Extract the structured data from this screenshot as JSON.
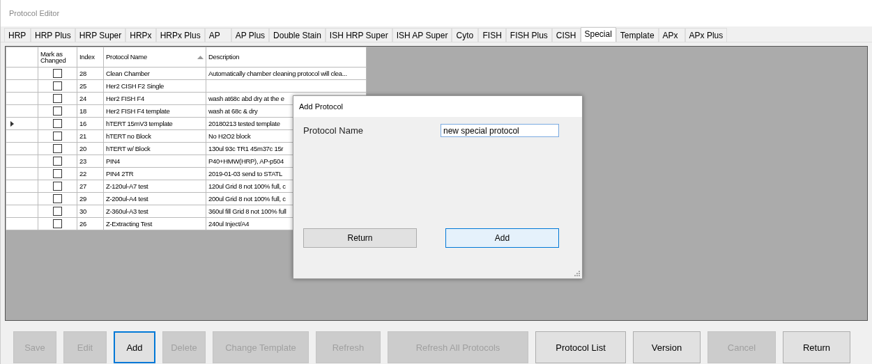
{
  "window": {
    "title": "Protocol Editor"
  },
  "tabs": [
    {
      "label": "HRP",
      "selected": false
    },
    {
      "label": "HRP Plus",
      "selected": false
    },
    {
      "label": "HRP Super",
      "selected": false
    },
    {
      "label": "HRPx",
      "selected": false
    },
    {
      "label": "HRPx Plus",
      "selected": false
    },
    {
      "label": "AP",
      "selected": false
    },
    {
      "label": "AP Plus",
      "selected": false
    },
    {
      "label": "Double Stain",
      "selected": false
    },
    {
      "label": "ISH HRP Super",
      "selected": false
    },
    {
      "label": "ISH AP Super",
      "selected": false
    },
    {
      "label": "Cyto",
      "selected": false
    },
    {
      "label": "FISH",
      "selected": false
    },
    {
      "label": "FISH Plus",
      "selected": false
    },
    {
      "label": "CISH",
      "selected": false
    },
    {
      "label": "Special",
      "selected": true
    },
    {
      "label": "Template",
      "selected": false
    },
    {
      "label": "APx",
      "selected": false
    },
    {
      "label": "APx Plus",
      "selected": false
    }
  ],
  "table": {
    "columns": [
      {
        "label": "Mark as Changed",
        "sorted": false
      },
      {
        "label": "Index",
        "sorted": false
      },
      {
        "label": "Protocol Name",
        "sorted": true
      },
      {
        "label": "Description",
        "sorted": false
      }
    ],
    "rows": [
      {
        "current": false,
        "checked": false,
        "index": "28",
        "name": "Clean Chamber",
        "description": "Automatically chamber cleaning protocol will clea..."
      },
      {
        "current": false,
        "checked": false,
        "index": "25",
        "name": "Her2 CISH F2 Single"
      },
      {
        "current": false,
        "checked": false,
        "index": "24",
        "name": "Her2 FISH F4",
        "description": "wash at68c abd dry at the e"
      },
      {
        "current": false,
        "checked": false,
        "index": "18",
        "name": "Her2 FISH F4 template",
        "description": "wash at 68c & dry"
      },
      {
        "current": true,
        "checked": false,
        "index": "16",
        "name": "hTERT 15mV3 template",
        "description": "20180213 tested template"
      },
      {
        "current": false,
        "checked": false,
        "index": "21",
        "name": "hTERT no Block",
        "description": "No H2O2 block"
      },
      {
        "current": false,
        "checked": false,
        "index": "20",
        "name": "hTERT w/ Block",
        "description": "130ul 93c TR1 45m37c 15r"
      },
      {
        "current": false,
        "checked": false,
        "index": "23",
        "name": "PIN4",
        "description": "P40+HMW(HRP), AP-p504"
      },
      {
        "current": false,
        "checked": false,
        "index": "22",
        "name": "PIN4 2TR",
        "description": "2019-01-03 send to STATL"
      },
      {
        "current": false,
        "checked": false,
        "index": "27",
        "name": "Z-120ul-A7 test",
        "description": "120ul Grid 8 not 100% full, c"
      },
      {
        "current": false,
        "checked": false,
        "index": "29",
        "name": "Z-200ul-A4 test",
        "description": "200ul Grid 8 not 100% full, c"
      },
      {
        "current": false,
        "checked": false,
        "index": "30",
        "name": "Z-360ul-A3 test",
        "description": "360ul fill Grid 8 not 100% full"
      },
      {
        "current": false,
        "checked": false,
        "index": "26",
        "name": "Z-Extracting Test",
        "description": "240ul Inject/A4"
      }
    ]
  },
  "dialog": {
    "title": "Add Protocol",
    "field_label": "Protocol Name",
    "field_value": "new special protocol",
    "buttons": [
      {
        "label": "Return",
        "default": false
      },
      {
        "label": "Add",
        "default": true
      }
    ]
  },
  "buttons": [
    {
      "label": "Save",
      "disabled": true,
      "focused": false
    },
    {
      "label": "Edit",
      "disabled": true,
      "focused": false
    },
    {
      "label": "Add",
      "disabled": false,
      "focused": true
    },
    {
      "label": "Delete",
      "disabled": true,
      "focused": false
    },
    {
      "label": "Change Template",
      "disabled": true,
      "focused": false
    },
    {
      "label": "Refresh",
      "disabled": true,
      "focused": false
    },
    {
      "label": "Refresh All Protocols",
      "disabled": true,
      "focused": false
    },
    {
      "label": "Protocol List",
      "disabled": false,
      "focused": false
    },
    {
      "label": "Version",
      "disabled": false,
      "focused": false
    },
    {
      "label": "Cancel",
      "disabled": true,
      "focused": false
    },
    {
      "label": "Return",
      "disabled": false,
      "focused": false
    }
  ]
}
